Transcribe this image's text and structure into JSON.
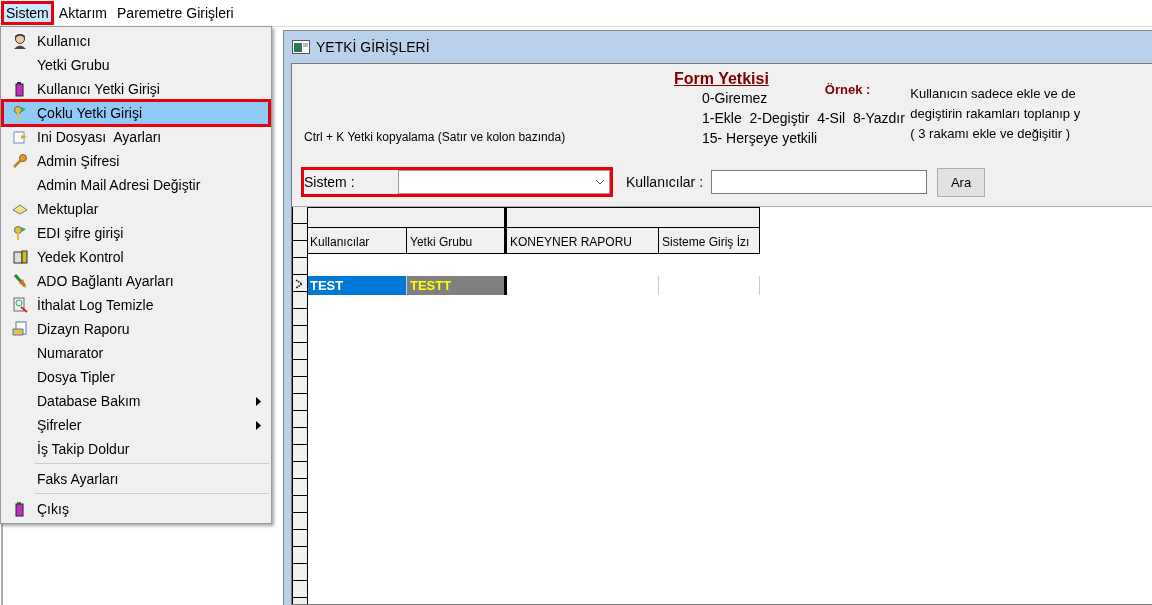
{
  "menu_bar": [
    {
      "label": "Sistem",
      "selected": true,
      "outlined": true
    },
    {
      "label": "Aktarım",
      "selected": false,
      "outlined": false
    },
    {
      "label": "Paremetre Girişleri",
      "selected": false,
      "outlined": false
    }
  ],
  "menu": [
    {
      "label": "Kullanıcı",
      "selected": false,
      "outlined": false,
      "submenu": false,
      "separator_before": false
    },
    {
      "label": "Yetki Grubu",
      "selected": false,
      "outlined": false,
      "submenu": false,
      "separator_before": false
    },
    {
      "label": "Kullanıcı Yetki Girişi",
      "selected": false,
      "outlined": false,
      "submenu": false,
      "separator_before": false
    },
    {
      "label": "Çoklu Yetki Girişi",
      "selected": true,
      "outlined": true,
      "submenu": false,
      "separator_before": false
    },
    {
      "label": "Ini Dosyası  Ayarları",
      "selected": false,
      "outlined": false,
      "submenu": false,
      "separator_before": false
    },
    {
      "label": "Admin Şifresi",
      "selected": false,
      "outlined": false,
      "submenu": false,
      "separator_before": false
    },
    {
      "label": "Admin Mail Adresi Değiştir",
      "selected": false,
      "outlined": false,
      "submenu": false,
      "separator_before": false
    },
    {
      "label": "Mektuplar",
      "selected": false,
      "outlined": false,
      "submenu": false,
      "separator_before": false
    },
    {
      "label": "EDI şifre girişi",
      "selected": false,
      "outlined": false,
      "submenu": false,
      "separator_before": false
    },
    {
      "label": "Yedek Kontrol",
      "selected": false,
      "outlined": false,
      "submenu": false,
      "separator_before": false
    },
    {
      "label": "ADO Bağlantı Ayarları",
      "selected": false,
      "outlined": false,
      "submenu": false,
      "separator_before": false
    },
    {
      "label": "İthalat Log Temizle",
      "selected": false,
      "outlined": false,
      "submenu": false,
      "separator_before": false
    },
    {
      "label": "Dizayn Raporu",
      "selected": false,
      "outlined": false,
      "submenu": false,
      "separator_before": false
    },
    {
      "label": "Numarator",
      "selected": false,
      "outlined": false,
      "submenu": false,
      "separator_before": false
    },
    {
      "label": "Dosya Tipler",
      "selected": false,
      "outlined": false,
      "submenu": false,
      "separator_before": false
    },
    {
      "label": "Database Bakım",
      "selected": false,
      "outlined": false,
      "submenu": true,
      "separator_before": false
    },
    {
      "label": "Şifreler",
      "selected": false,
      "outlined": false,
      "submenu": true,
      "separator_before": false
    },
    {
      "label": "İş Takip Doldur",
      "selected": false,
      "outlined": false,
      "submenu": false,
      "separator_before": false
    },
    {
      "label": "Faks Ayarları",
      "selected": false,
      "outlined": false,
      "submenu": false,
      "separator_before": true
    },
    {
      "label": "Çıkış",
      "selected": false,
      "outlined": false,
      "submenu": false,
      "separator_before": true
    }
  ],
  "window": {
    "title": "YETKİ GİRİŞLERİ"
  },
  "form": {
    "shortcut_hint": "Ctrl + K Yetki kopyalama (Satır ve kolon bazında)",
    "legend_title": "Form Yetkisi",
    "legend_lines": [
      "0-Giremez",
      "1-Ekle  2-Degiştir  4-Sil  8-Yazdır",
      "15- Herşeye yetkili"
    ],
    "example_label": "Örnek :",
    "example_lines": [
      "Kullanıcın sadece ekle ve de",
      "degiştirin rakamları toplanıp y",
      "( 3 rakamı ekle ve değişitir )"
    ],
    "sistem": {
      "label": "Sistem :",
      "outlined": true
    },
    "users": {
      "label": "Kullanıcılar :"
    },
    "search_button": "Ara"
  },
  "table": {
    "columns": [
      "Kullanıcılar",
      "Yetki Grubu",
      "KONEYNER RAPORU",
      "Sisteme Giriş İzı"
    ],
    "rows": [
      {
        "selected": true,
        "cells": [
          "TEST",
          "TESTT",
          "",
          ""
        ]
      }
    ]
  }
}
